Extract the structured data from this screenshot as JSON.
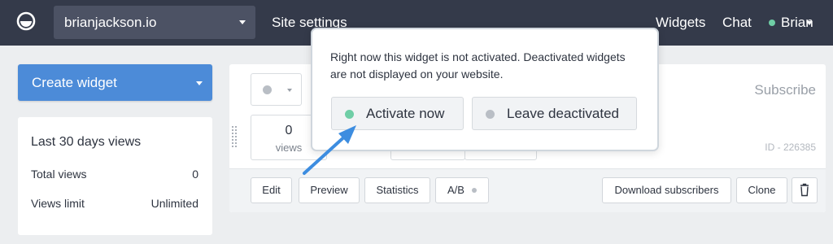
{
  "header": {
    "site_name": "brianjackson.io",
    "site_settings": "Site settings",
    "widgets": "Widgets",
    "chat": "Chat",
    "user_name": "Brian"
  },
  "sidebar": {
    "create_widget": "Create widget",
    "stats": {
      "title": "Last 30 days views",
      "total_views_label": "Total views",
      "total_views_value": "0",
      "views_limit_label": "Views limit",
      "views_limit_value": "Unlimited"
    }
  },
  "widget": {
    "name": "Subscribe",
    "id_label": "ID - 226385",
    "views_value": "0",
    "views_label": "views",
    "actions": {
      "edit": "Edit",
      "preview": "Preview",
      "statistics": "Statistics",
      "ab": "A/B",
      "download_subscribers": "Download subscribers",
      "clone": "Clone"
    }
  },
  "popover": {
    "message": "Right now this widget is not activated. Deactivated widgets are not displayed on your website.",
    "activate_now": "Activate now",
    "leave_deactivated": "Leave deactivated"
  },
  "colors": {
    "topbar": "#343a4a",
    "primary": "#4c8bd8",
    "active_green": "#6fcea6",
    "inactive_gray": "#b9bec5",
    "arrow_blue": "#3d8de0"
  },
  "icons": {
    "logo": "brand-logo-icon",
    "trash": "trash-icon",
    "drag": "drag-handle-icon",
    "arrow": "pointer-arrow-icon"
  }
}
